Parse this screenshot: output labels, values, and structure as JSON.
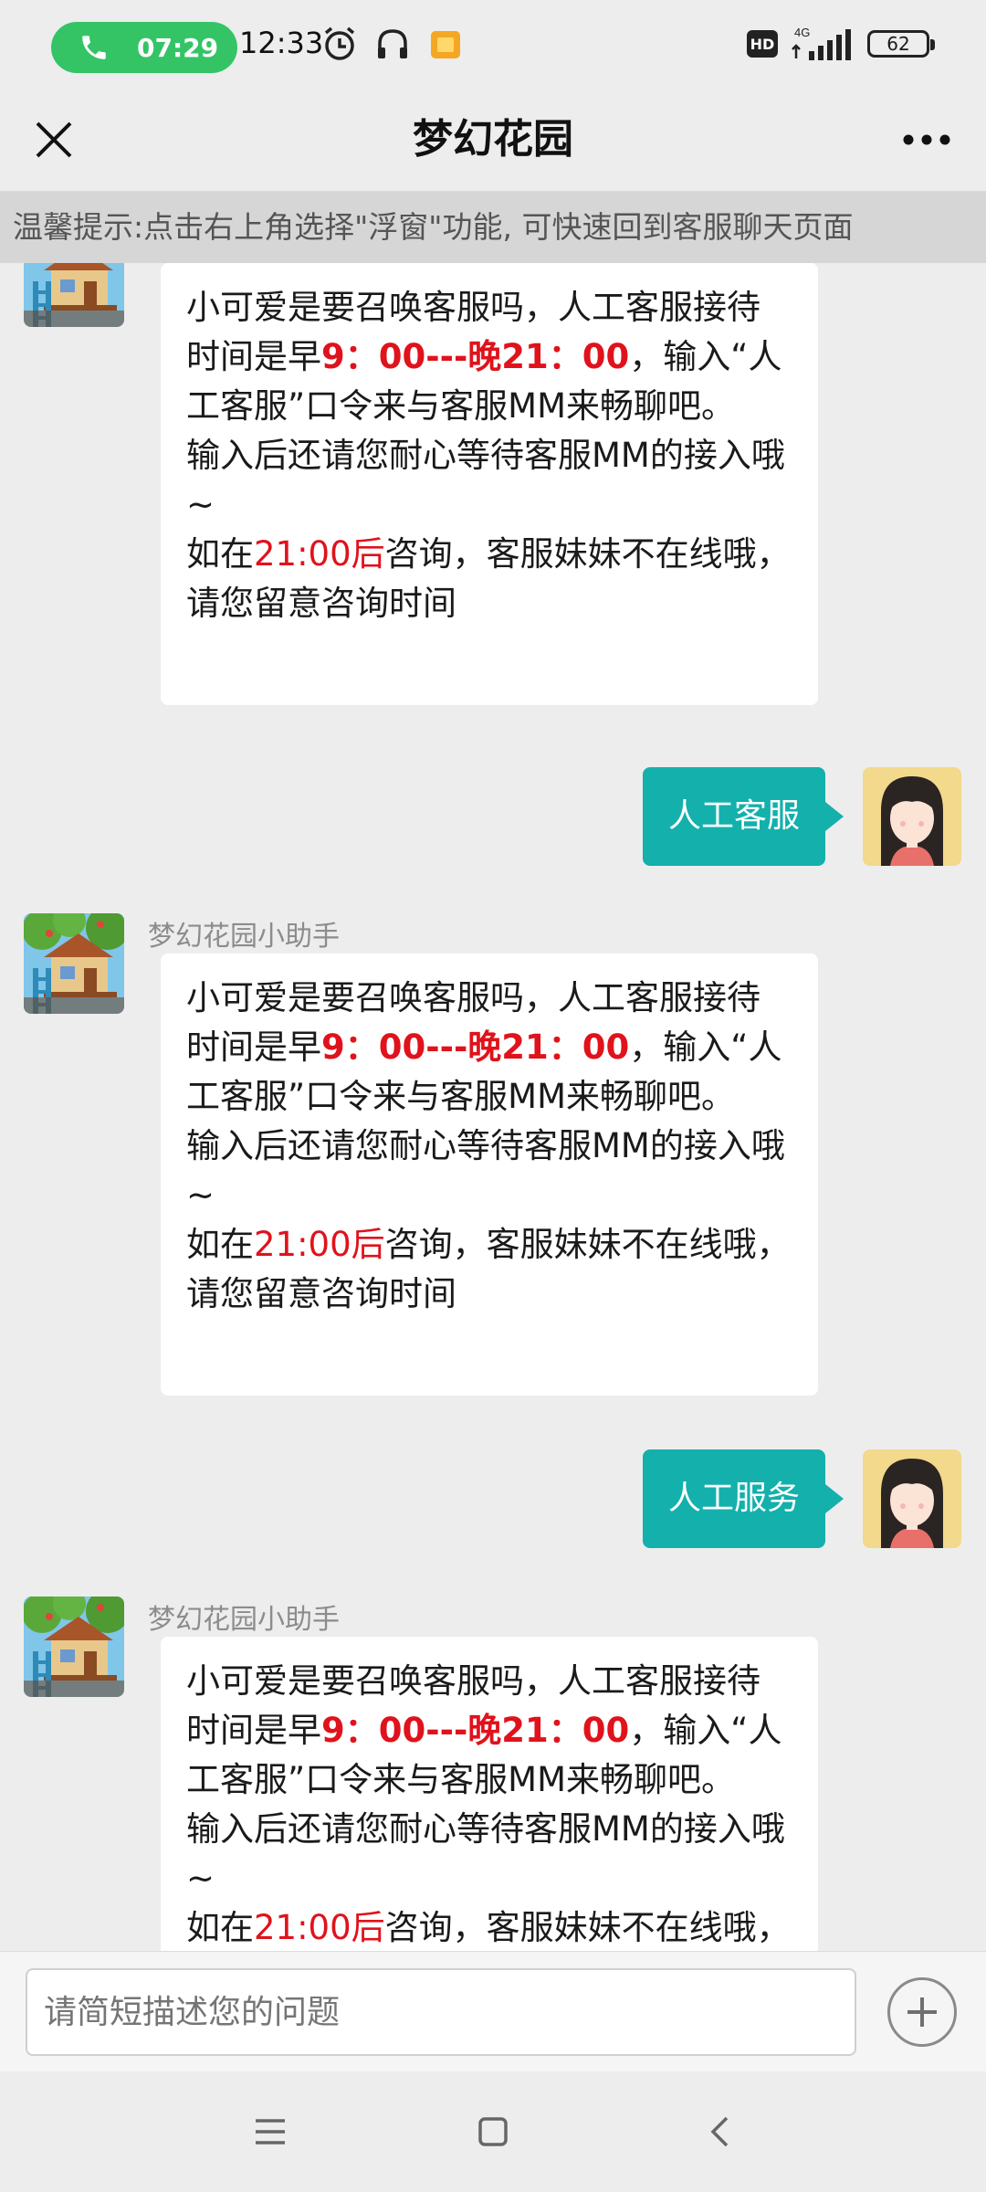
{
  "status_bar": {
    "call_time": "07:29",
    "clock": "12:33",
    "hd": "HD",
    "network": "4G",
    "battery": "62",
    "icons": [
      "phone-icon",
      "alarm-icon",
      "headphones-icon",
      "notes-icon",
      "signal-icon",
      "battery-icon"
    ]
  },
  "header": {
    "title": "梦幻花园",
    "close_icon": "close-icon",
    "more_icon": "more-icon"
  },
  "notice": {
    "text": "温馨提示:点击右上角选择\"浮窗\"功能, 可快速回到客服聊天页面"
  },
  "bot_reply": {
    "line1a": "小可爱是要召唤客服吗，人工客服接待时间是早",
    "hours": "9：00---晚21：00",
    "line1b": "，输入“人工客服”口令来与客服MM来畅聊吧。",
    "line2": "输入后还请您耐心等待客服MM的接入哦~",
    "line3a": "如在",
    "after_time": "21:00后",
    "line3b": "咨询，客服妹妹不在线哦，请您留意咨询时间"
  },
  "messages": {
    "bot_name": "梦幻花园小助手",
    "user_msg_1": "人工客服",
    "user_msg_2": "人工服务"
  },
  "input": {
    "placeholder": "请简短描述您的问题",
    "add_icon": "plus-icon"
  },
  "nav": {
    "icons": [
      "menu-icon",
      "home-icon",
      "back-icon"
    ]
  },
  "colors": {
    "accent": "#13b0ac",
    "highlight": "#e0121b",
    "call_pill": "#34c466"
  }
}
